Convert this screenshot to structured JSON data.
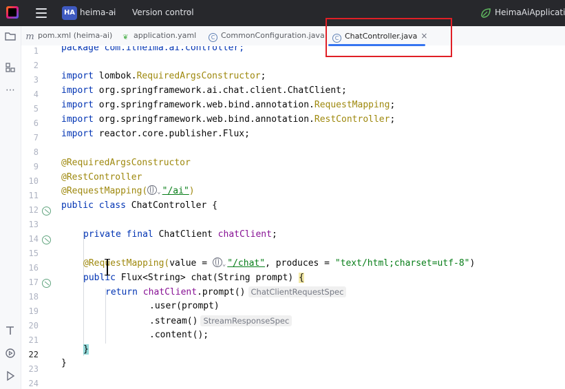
{
  "titlebar": {
    "project_badge": "HA",
    "project_name": "heima-ai",
    "vcs_label": "Version control",
    "run_config": "HeimaAiApplication"
  },
  "tabs": [
    {
      "label": "pom.xml (heima-ai)",
      "icon": "maven-icon"
    },
    {
      "label": "application.yaml",
      "icon": "spring-leaf-icon"
    },
    {
      "label": "CommonConfiguration.java",
      "icon": "class-icon"
    },
    {
      "label": "ChatController.java",
      "icon": "class-icon",
      "active": true,
      "close": "×"
    }
  ],
  "gutter": {
    "line_numbers": [
      "1",
      "2",
      "3",
      "4",
      "5",
      "6",
      "7",
      "8",
      "9",
      "10",
      "11",
      "12",
      "13",
      "14",
      "15",
      "16",
      "17",
      "18",
      "19",
      "20",
      "21",
      "22",
      "23",
      "24"
    ],
    "current_line": "22"
  },
  "code": {
    "l1": "package com.itheima.ai.controller;",
    "l3_kw": "import",
    "l3_rest": " lombok.",
    "l3_ann": "RequiredArgsConstructor",
    "l3_end": ";",
    "l4_kw": "import",
    "l4_rest": " org.springframework.ai.chat.client.ChatClient;",
    "l5_kw": "import",
    "l5_rest": " org.springframework.web.bind.annotation.",
    "l5_ann": "RequestMapping",
    "l5_end": ";",
    "l6_kw": "import",
    "l6_rest": " org.springframework.web.bind.annotation.",
    "l6_ann": "RestController",
    "l6_end": ";",
    "l7_kw": "import",
    "l7_rest": " reactor.core.publisher.Flux;",
    "l9": "@RequiredArgsConstructor",
    "l10": "@RestController",
    "l11_ann": "@RequestMapping(",
    "l11_str": "\"/ai\"",
    "l11_end": ")",
    "l12_kw": "public class",
    "l12_rest": " ChatController {",
    "l14_kw": "private final",
    "l14_rest": " ChatClient ",
    "l14_fld": "chatClient",
    "l14_end": ";",
    "l16_ann": "@RequestMapping(",
    "l16_rest1": "value = ",
    "l16_str1": "\"/chat\"",
    "l16_rest2": ", produces = ",
    "l16_str2": "\"text/html;charset=utf-8\"",
    "l16_end": ")",
    "l17_kw": "public",
    "l17_rest": " Flux<String> chat(String prompt) ",
    "l17_brace": "{",
    "l18_kw": "return",
    "l18_fld": " chatClient",
    "l18_rest": ".prompt()",
    "l18_hint": "ChatClientRequestSpec",
    "l19": ".user(prompt)",
    "l20": ".stream()",
    "l20_hint": "StreamResponseSpec",
    "l21": ".content();",
    "l22": "}",
    "l23": "}"
  },
  "colors": {
    "keyword": "#0033b3",
    "annotation": "#9e880d",
    "string": "#067d17",
    "field": "#871094",
    "highlight_box": "#e01f26",
    "tab_underline": "#3574f0"
  },
  "toolstrip_icons": [
    "folder-icon",
    "structure-icon",
    "more-icon",
    "build-icon",
    "services-icon",
    "run-icon"
  ]
}
